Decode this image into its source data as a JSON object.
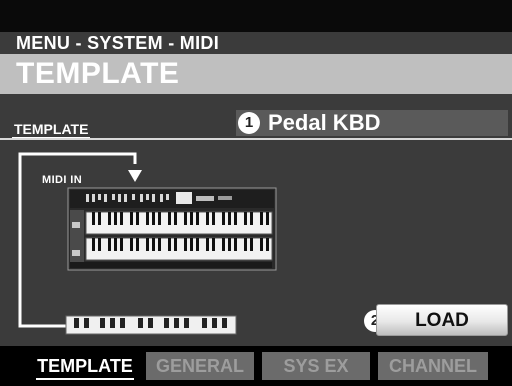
{
  "header": {
    "path": "MENU - SYSTEM - MIDI",
    "title": "TEMPLATE"
  },
  "parameter": {
    "label": "TEMPLATE",
    "value": "Pedal KBD",
    "callout": "1"
  },
  "diagram": {
    "midi_in_label": "MIDI IN"
  },
  "load_button": {
    "label": "LOAD",
    "callout": "2"
  },
  "tabs": [
    {
      "label": "TEMPLATE",
      "active": true
    },
    {
      "label": "GENERAL",
      "active": false
    },
    {
      "label": "SYS EX",
      "active": false
    },
    {
      "label": "CHANNEL",
      "active": false
    }
  ],
  "colors": {
    "screen_bg": "#3b3b3b",
    "title_band": "#bfbfbf",
    "inactive_tab": "#6b6b6b",
    "routing_line": "#ffffff"
  }
}
